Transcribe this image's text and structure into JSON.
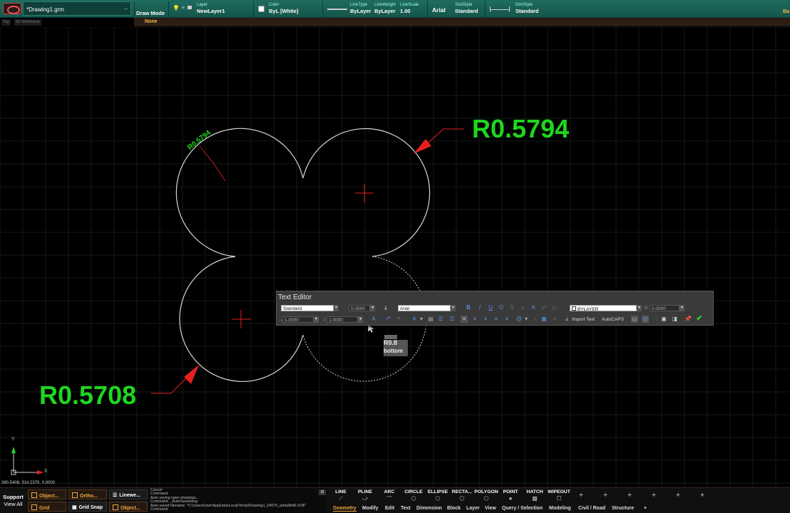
{
  "app": {
    "document_name": "*Drawing1.grm",
    "draw_mode_label": "Draw Mode",
    "right_tag": "Ba"
  },
  "props": {
    "layer": {
      "label": "Layer",
      "value": "NewLayer1"
    },
    "color": {
      "label": "Color",
      "value": "ByL [White]"
    },
    "linetype": {
      "label": "LineType",
      "value": "ByLayer"
    },
    "lineweight": {
      "label": "LineWeight",
      "value": "ByLayer"
    },
    "linescale": {
      "label": "LineScale",
      "value": "1.00"
    },
    "font": {
      "value": "Arial"
    },
    "textstyle": {
      "label": "TextStyle",
      "value": "Standard"
    },
    "dimstyle": {
      "label": "DimStyle",
      "value": "Standard"
    }
  },
  "subbar": {
    "tab1": "Top",
    "tab2": "2D Wireframe",
    "none_label": "None"
  },
  "drawing": {
    "dim_top_right": "R0.5794",
    "dim_top_left_small": "R0.5794",
    "dim_bottom_left": "R0.5708",
    "edit_text_line1": "R0.8",
    "edit_text_line2": "bottom",
    "colors": {
      "dimension": "#1fd61f",
      "arrow": "#e62020",
      "geometry": "#d8d8d8",
      "grid": "#151a18"
    }
  },
  "text_editor": {
    "title": "Text Editor",
    "style": "Standard",
    "height": "0.0500",
    "font": "Arial",
    "color": "BYLAYER",
    "oblique": "0.0000",
    "width_factor": "1.0000",
    "line_spacing": "1.0000",
    "import_text": "Import Text",
    "autocaps": "AutoCAPS"
  },
  "coordinates": {
    "readout": "390.5408, 314.2370, 0.0000",
    "axis_y": "Y",
    "axis_x": "X"
  },
  "status": {
    "support": "Support",
    "view_all": "View All",
    "object_snap": "Object...",
    "ortho": "Ortho...",
    "lineweight": "Linewe...",
    "grid": "Grid",
    "grid_snap": "Grid Snap",
    "object_track": "Object..."
  },
  "command_log": [
    "Cancel",
    "Command",
    "Auto saving open drawings...",
    "Command: _AutoSaveHang",
    "Auto saved filename: \"C:\\Users\\User\\AppData\\Local\\Temp\\Drawing1_04570_a0da0b45.SV$\"",
    "Command"
  ],
  "ribbon": {
    "tools": [
      {
        "label": "LINE",
        "glyph": "⟋"
      },
      {
        "label": "PLINE",
        "glyph": "⤻"
      },
      {
        "label": "ARC",
        "glyph": "⌒"
      },
      {
        "label": "CIRCLE",
        "glyph": "⬠"
      },
      {
        "label": "ELLIPSE",
        "glyph": "⬠"
      },
      {
        "label": "RECTA...",
        "glyph": "⬠"
      },
      {
        "label": "POLYGON",
        "glyph": "⬠"
      },
      {
        "label": "POINT",
        "glyph": "●"
      },
      {
        "label": "HATCH",
        "glyph": "▩"
      },
      {
        "label": "WIPEOUT",
        "glyph": "☐"
      }
    ],
    "plus": "+",
    "tabs": [
      "Geometry",
      "Modify",
      "Edit",
      "Text",
      "Dimension",
      "Block",
      "Layer",
      "View",
      "Query / Selection",
      "Modeling",
      "Civil / Road",
      "Structure",
      "+"
    ]
  }
}
